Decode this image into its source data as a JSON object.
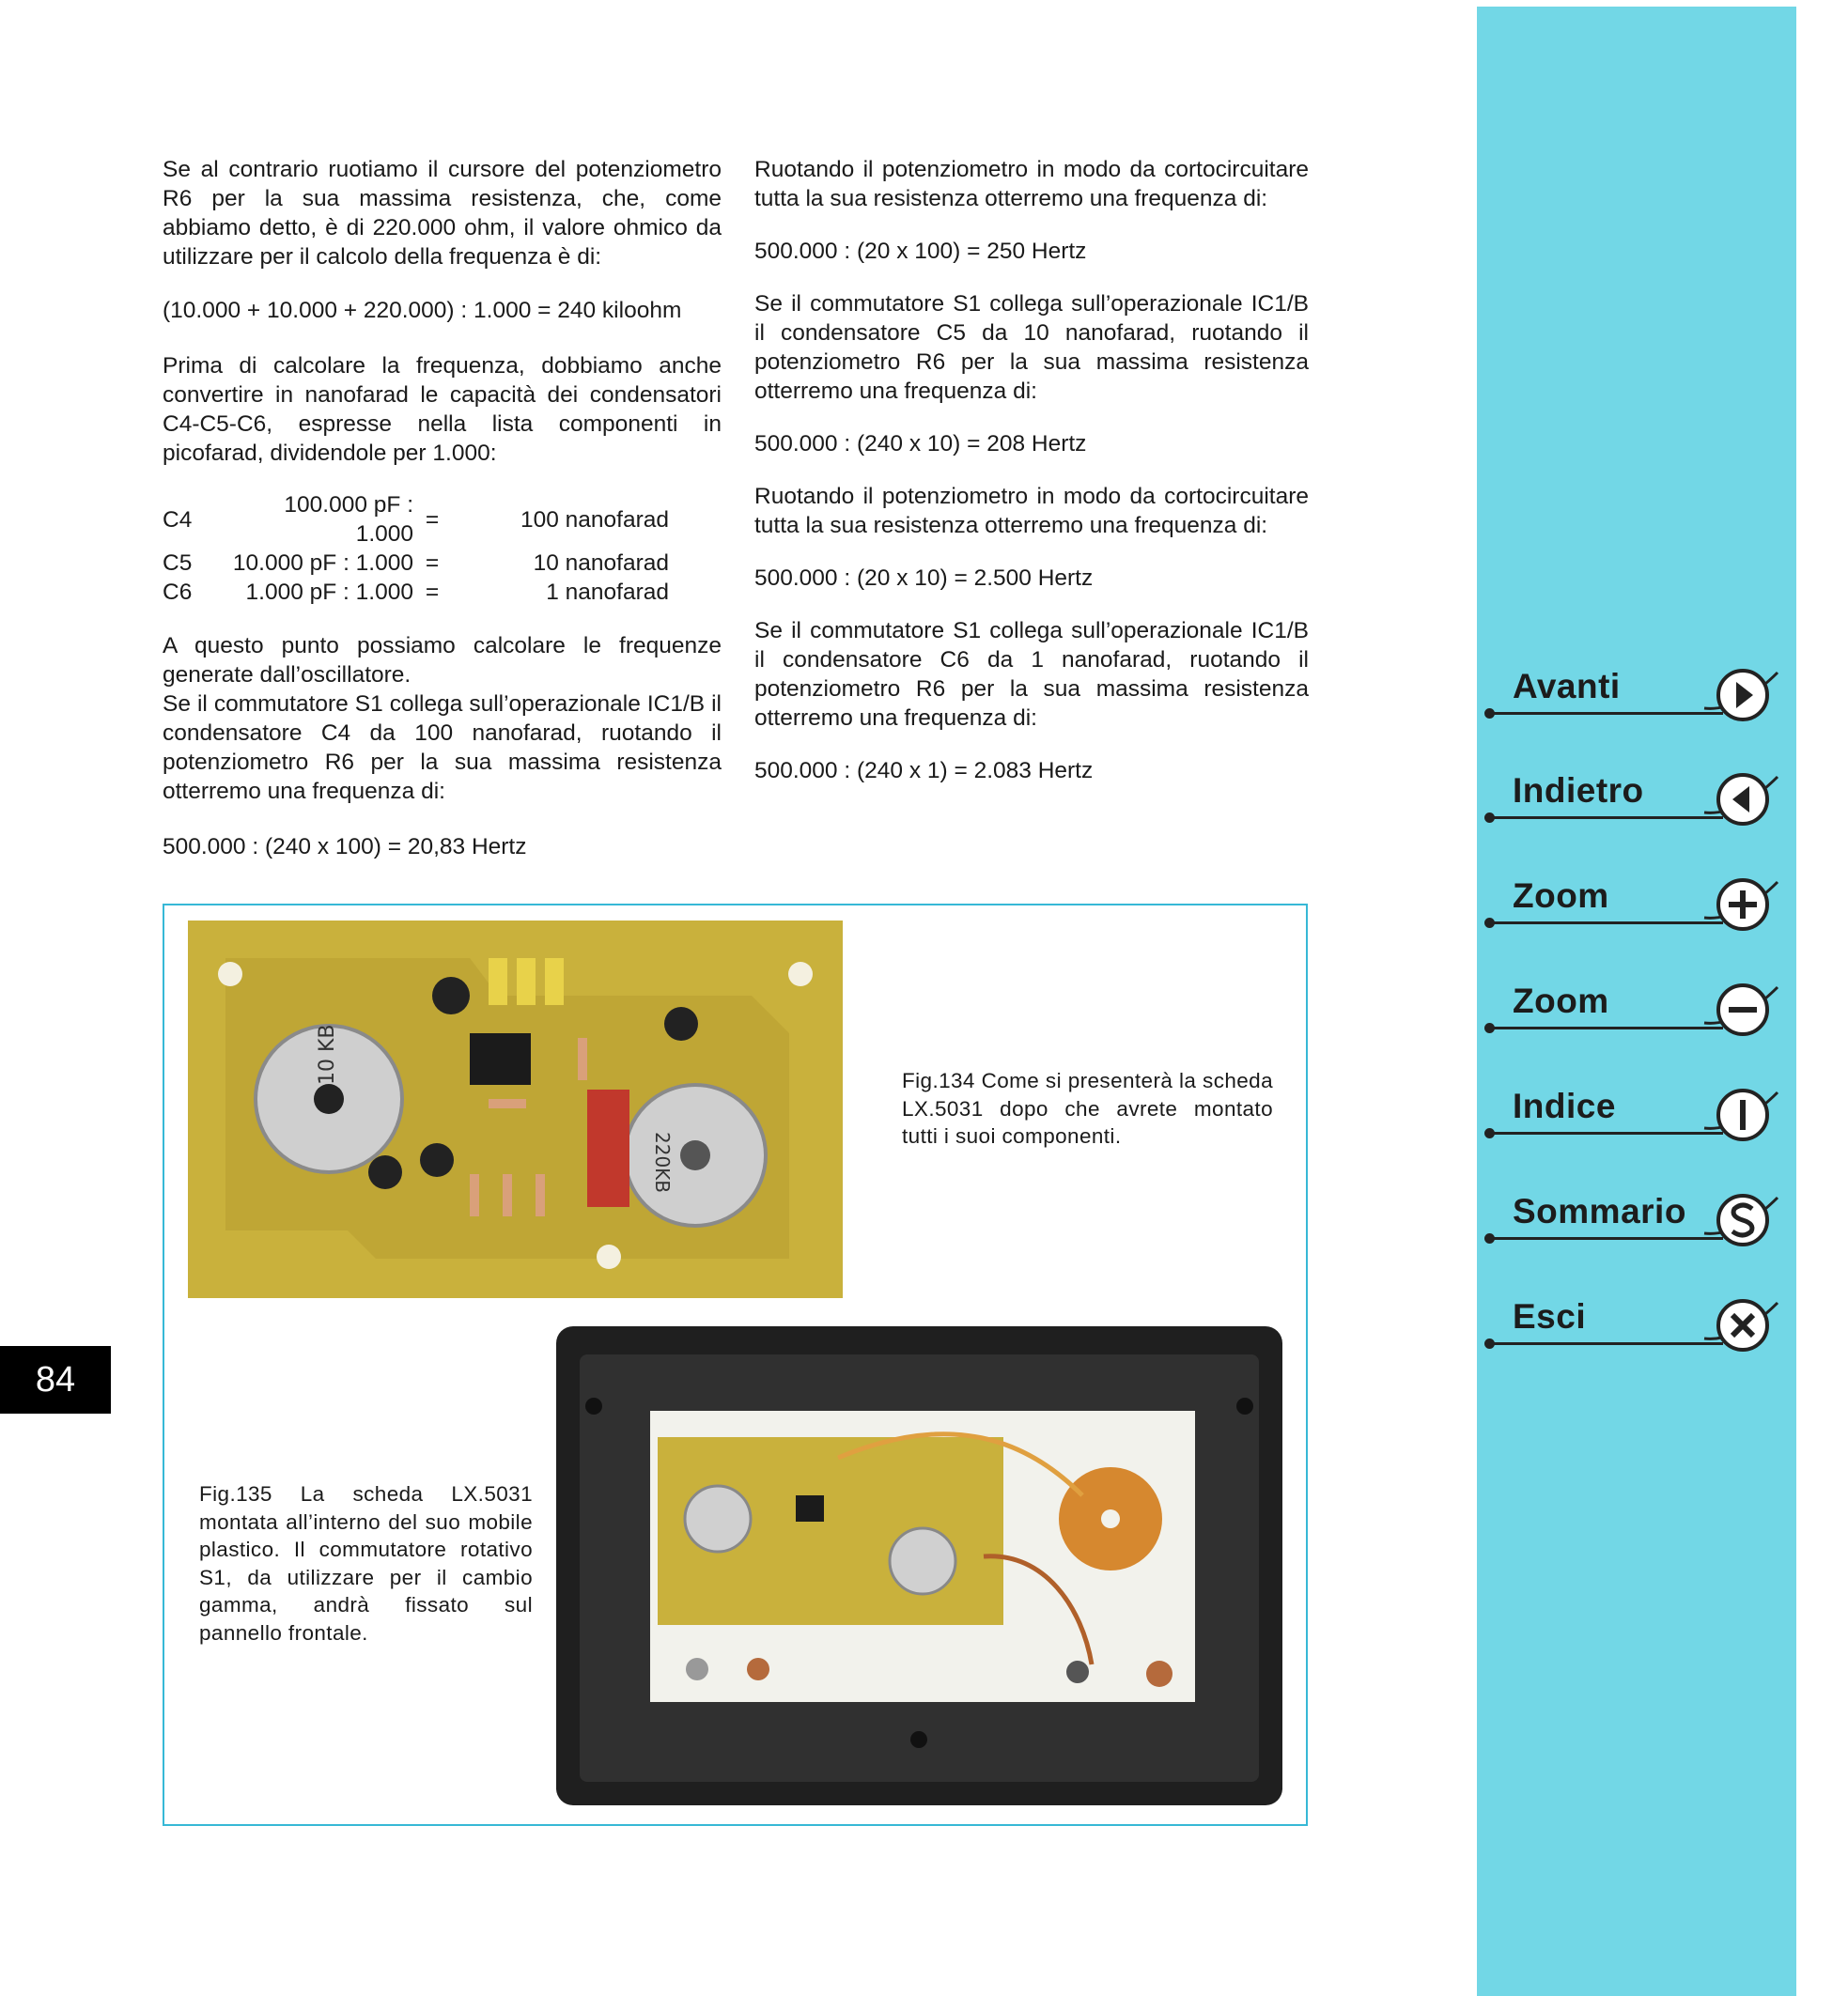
{
  "page_number": "84",
  "left_column": {
    "p1": "Se al contrario ruotiamo il cursore del potenziometro R6 per la sua massima resistenza, che, come abbiamo detto, è di 220.000 ohm, il valore ohmico da utilizzare per il calcolo della frequenza è di:",
    "f1": "(10.000 + 10.000 + 220.000) : 1.000 = 240 kiloohm",
    "p2": "Prima di calcolare la frequenza, dobbiamo anche convertire in nanofarad le capacità dei condensatori C4-C5-C6, espresse nella lista componenti in picofarad, dividendole per 1.000:",
    "caps": [
      {
        "name": "C4",
        "pf": "100.000 pF : 1.000",
        "eq": "=",
        "nf": "100 nanofarad"
      },
      {
        "name": "C5",
        "pf": "10.000 pF : 1.000",
        "eq": "=",
        "nf": "10 nanofarad"
      },
      {
        "name": "C6",
        "pf": "1.000 pF : 1.000",
        "eq": "=",
        "nf": "1 nanofarad"
      }
    ],
    "p3a": "A questo punto possiamo calcolare le frequenze generate dall’oscillatore.",
    "p3b": "Se il commutatore S1 collega sull’operazionale IC1/B il condensatore C4 da 100 nanofarad, ruotando il potenziometro R6 per la sua massima resistenza otterremo una frequenza di:",
    "f2": "500.000 : (240 x 100) = 20,83 Hertz"
  },
  "right_column": {
    "p1": "Ruotando il potenziometro in modo da cortocircuitare tutta la sua resistenza otterremo una frequenza di:",
    "f1": "500.000 : (20 x 100) = 250 Hertz",
    "p2": "Se il commutatore S1 collega sull’operazionale IC1/B il condensatore C5 da 10 nanofarad, ruotando il potenziometro R6 per la sua massima resistenza otterremo una frequenza di:",
    "f2": "500.000 : (240 x 10) = 208 Hertz",
    "p3": "Ruotando il potenziometro in modo da cortocircuitare tutta la sua resistenza otterremo una frequenza di:",
    "f3": "500.000 : (20 x 10) = 2.500 Hertz",
    "p4": "Se il commutatore S1 collega sull’operazionale IC1/B il condensatore C6 da 1 nanofarad, ruotando il potenziometro R6 per la sua massima resistenza otterremo una frequenza di:",
    "f4": "500.000 : (240 x 1) = 2.083 Hertz"
  },
  "figures": {
    "fig134": {
      "caption": "Fig.134 Come si presenterà la scheda LX.5031 dopo che avrete montato tutti i suoi componenti.",
      "labels": {
        "pot1": "10 KB",
        "pot2": "220KB"
      }
    },
    "fig135": {
      "caption": "Fig.135 La scheda LX.5031 montata all’interno del suo mobile plastico. Il commutatore rotativo S1, da utilizzare per il cambio gamma, andrà fissato sul pannello frontale."
    }
  },
  "navigation": [
    {
      "label": "Avanti",
      "icon": "arrow-right-icon"
    },
    {
      "label": "Indietro",
      "icon": "arrow-left-icon"
    },
    {
      "label": "Zoom",
      "icon": "zoom-in-icon"
    },
    {
      "label": "Zoom",
      "icon": "zoom-out-icon"
    },
    {
      "label": "Indice",
      "icon": "index-icon"
    },
    {
      "label": "Sommario",
      "icon": "summary-icon"
    },
    {
      "label": "Esci",
      "icon": "exit-icon"
    }
  ],
  "colors": {
    "sidebar": "#72d7e6",
    "figure_border": "#37b8d6",
    "pcb": "#c9b13c"
  }
}
